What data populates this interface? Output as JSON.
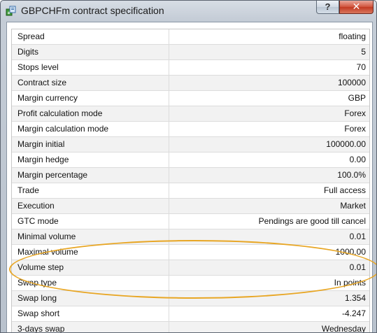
{
  "window": {
    "title": "GBPCHFm contract specification",
    "help_label": "?",
    "close_label": "✕"
  },
  "spec_rows": [
    {
      "label": "Spread",
      "value": "floating"
    },
    {
      "label": "Digits",
      "value": "5"
    },
    {
      "label": "Stops level",
      "value": "70"
    },
    {
      "label": "Contract size",
      "value": "100000"
    },
    {
      "label": "Margin currency",
      "value": "GBP"
    },
    {
      "label": "Profit calculation mode",
      "value": "Forex"
    },
    {
      "label": "Margin calculation mode",
      "value": "Forex"
    },
    {
      "label": "Margin initial",
      "value": "100000.00"
    },
    {
      "label": "Margin hedge",
      "value": "0.00"
    },
    {
      "label": "Margin percentage",
      "value": "100.0%"
    },
    {
      "label": "Trade",
      "value": "Full access"
    },
    {
      "label": "Execution",
      "value": "Market"
    },
    {
      "label": "GTC mode",
      "value": "Pendings are good till cancel"
    },
    {
      "label": "Minimal volume",
      "value": "0.01"
    },
    {
      "label": "Maximal volume",
      "value": "1000.00"
    },
    {
      "label": "Volume step",
      "value": "0.01"
    },
    {
      "label": "Swap type",
      "value": "In points"
    },
    {
      "label": "Swap long",
      "value": "1.354"
    },
    {
      "label": "Swap short",
      "value": "-4.247"
    },
    {
      "label": "3-days swap",
      "value": "Wednesday"
    }
  ],
  "colors": {
    "highlight": "#e8a624",
    "row_alt": "#f2f2f2"
  }
}
